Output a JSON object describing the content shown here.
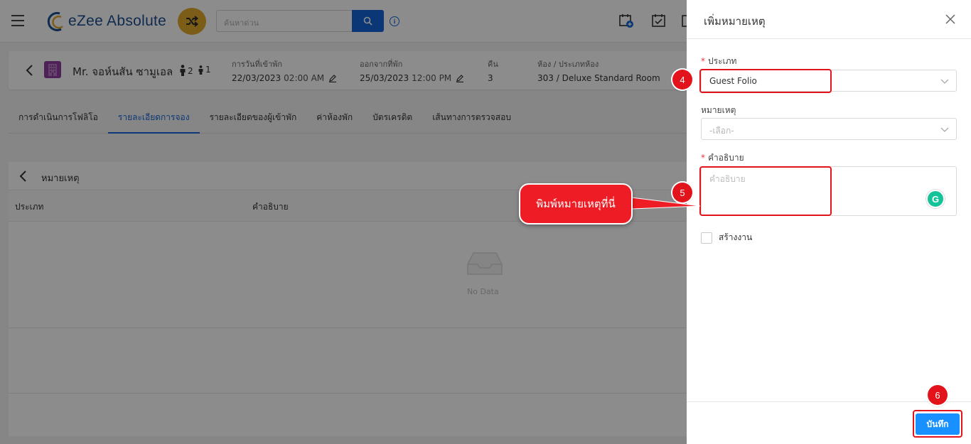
{
  "app": {
    "name": "eZee Absolute",
    "search_placeholder": "ค้นหาด่วน",
    "info_symbol": "i"
  },
  "guest": {
    "name": "Mr. จอห์นสัน ซามูเอล",
    "adults": "2",
    "children": "1",
    "checkin_label": "การวันที่เข้าพัก",
    "checkin_date": "22/03/2023",
    "checkin_time": "02:00 AM",
    "checkout_label": "ออกจากที่พัก",
    "checkout_date": "25/03/2023",
    "checkout_time": "12:00 PM",
    "nights_label": "คืน",
    "nights": "3",
    "room_label": "ห้อง / ประเภทห้อง",
    "room": "303 / Deluxe Standard Room"
  },
  "tabs": [
    {
      "label": "การดำเนินการโฟลิโอ"
    },
    {
      "label": "รายละเอียดการจอง"
    },
    {
      "label": "รายละเอียดของผู้เข้าพัก"
    },
    {
      "label": "ค่าห้องพัก"
    },
    {
      "label": "บัตรเครดิต"
    },
    {
      "label": "เส้นทางการตรวจสอบ"
    }
  ],
  "notes": {
    "title": "หมายเหตุ",
    "columns": [
      "ประเภท",
      "คำอธิบาย"
    ],
    "empty_text": "No Data"
  },
  "drawer": {
    "title": "เพิ่มหมายเหตุ",
    "type_label": "ประเภท",
    "type_value": "Guest Folio",
    "note_label": "หมายเหตุ",
    "note_placeholder": "-เลือก-",
    "desc_label": "คำอธิบาย",
    "desc_placeholder": "คำอธิบาย",
    "create_task_label": "สร้างงาน",
    "save_label": "บันทึก",
    "required_mark": "*"
  },
  "annotations": {
    "step4": "4",
    "step5": "5",
    "step6": "6",
    "callout": "พิมพ์หมายเหตุที่นี่"
  },
  "colors": {
    "primary": "#1565d8",
    "accent": "#e2a92c",
    "annotation": "#e3131b",
    "save": "#1890ff"
  }
}
